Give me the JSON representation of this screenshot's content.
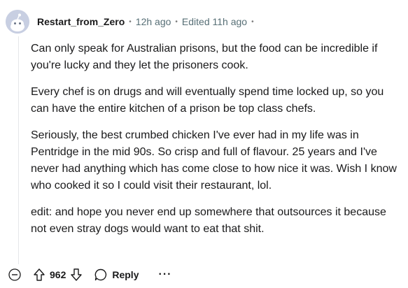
{
  "comment": {
    "author": "Restart_from_Zero",
    "time": "12h ago",
    "edited": "Edited 11h ago",
    "separator": "•",
    "paragraphs": [
      "Can only speak for Australian prisons, but the food can be incredible if you're lucky and they let the prisoners cook.",
      "Every chef is on drugs and will eventually spend time locked up, so you can have the entire kitchen of a prison be top class chefs.",
      "Seriously, the best crumbed chicken I've ever had in my life was in Pentridge in the mid 90s. So crisp and full of flavour. 25 years and I've never had anything which has come close to how nice it was. Wish I know who cooked it so I could visit their restaurant, lol.",
      "edit: and hope you never end up somewhere that outsources it because not even stray dogs would want to eat that shit."
    ]
  },
  "actions": {
    "collapse_icon": "minus-circle-icon",
    "upvote_icon": "arrow-up-icon",
    "score": "962",
    "downvote_icon": "arrow-down-icon",
    "reply_icon": "speech-bubble-icon",
    "reply_label": "Reply",
    "more_label": "···"
  },
  "colors": {
    "text": "#1a1a1b",
    "meta": "#576f76",
    "avatar_bg": "#c8cfe2",
    "thread_line": "#e5e7ea"
  }
}
